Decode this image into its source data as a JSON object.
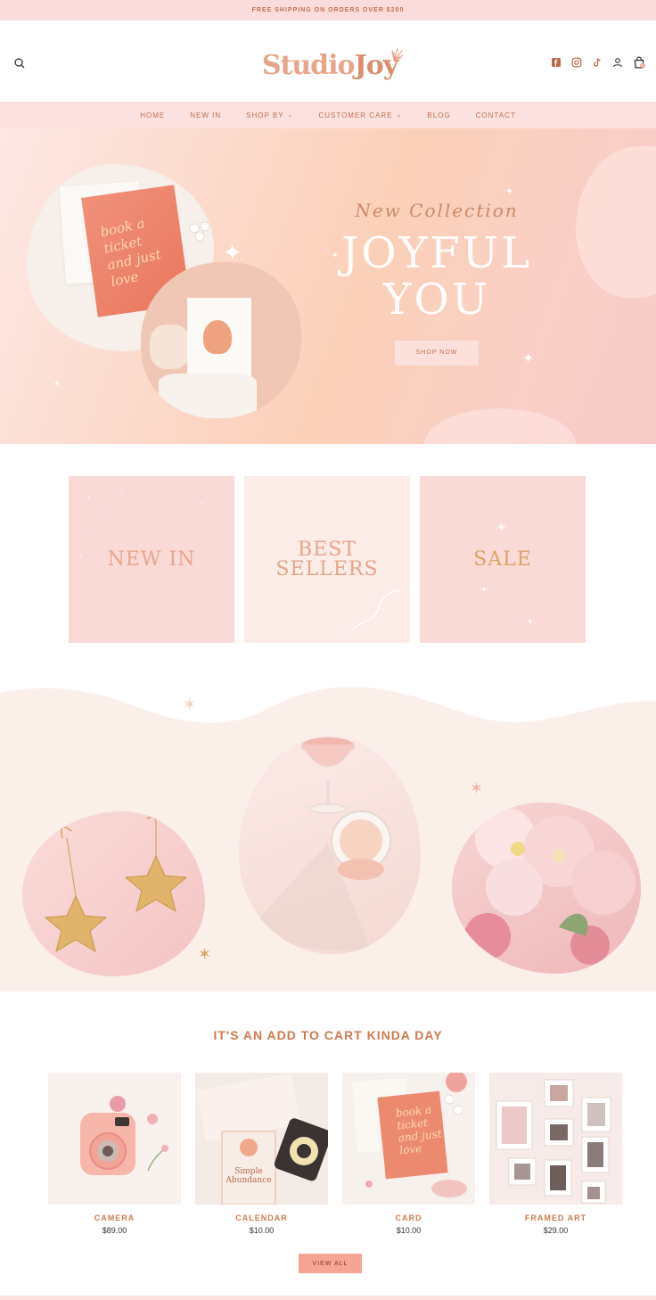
{
  "announcement": {
    "text": "FREE SHIPPING ON ORDERS OVER $200"
  },
  "brand": {
    "name_part1": "Studio",
    "name_part2": "Joy"
  },
  "header": {
    "icons": [
      "search-icon",
      "facebook-icon",
      "instagram-icon",
      "tiktok-icon",
      "account-icon",
      "cart-icon"
    ],
    "cart_count": "0"
  },
  "nav": {
    "items": [
      {
        "label": "HOME"
      },
      {
        "label": "NEW IN"
      },
      {
        "label": "SHOP BY",
        "dropdown": true
      },
      {
        "label": "CUSTOMER CARE",
        "dropdown": true
      },
      {
        "label": "BLOG"
      },
      {
        "label": "CONTACT"
      }
    ]
  },
  "hero": {
    "eyebrow": "New Collection",
    "title_line1": "JOYFUL",
    "title_line2": "YOU",
    "button": "SHOP NOW",
    "card_script": "book a ticket and just love",
    "card_script_lines": [
      "book a",
      "ticket",
      "and just",
      "love"
    ]
  },
  "categories": [
    {
      "label": "NEW IN"
    },
    {
      "label_line1": "BEST",
      "label_line2": "SELLERS"
    },
    {
      "label": "SALE"
    }
  ],
  "products": {
    "title": "IT'S AN ADD TO CART KINDA DAY",
    "items": [
      {
        "name": "CAMERA",
        "price": "$89.00"
      },
      {
        "name": "CALENDAR",
        "price": "$10.00",
        "book_title_line1": "Simple",
        "book_title_line2": "Abundance"
      },
      {
        "name": "CARD",
        "price": "$10.00"
      },
      {
        "name": "FRAMED ART",
        "price": "$29.00"
      }
    ],
    "view_all": "VIEW ALL"
  },
  "colors": {
    "accent": "#c0704b",
    "blush": "#fadad7",
    "nav_bg": "#fbe1df",
    "cta": "#f6a594"
  }
}
